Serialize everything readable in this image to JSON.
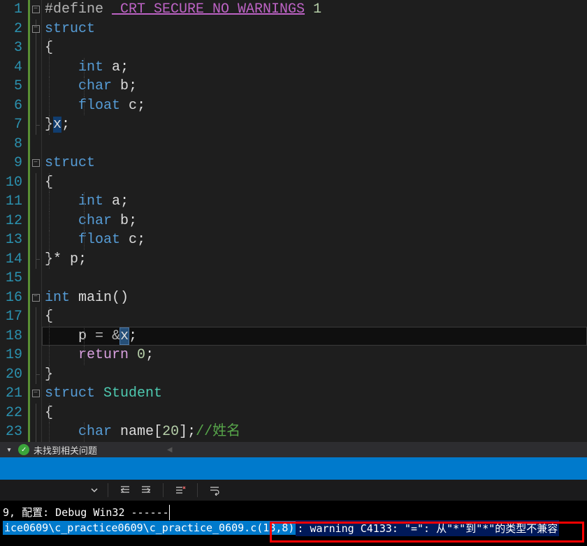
{
  "lines": [
    {
      "n": 1,
      "fold": "box",
      "indent": 0
    },
    {
      "n": 2,
      "fold": "box",
      "indent": 0
    },
    {
      "n": 3,
      "fold": "line",
      "indent": 1
    },
    {
      "n": 4,
      "fold": "line",
      "indent": 2
    },
    {
      "n": 5,
      "fold": "line",
      "indent": 2
    },
    {
      "n": 6,
      "fold": "line",
      "indent": 2
    },
    {
      "n": 7,
      "fold": "end",
      "indent": 1
    },
    {
      "n": 8,
      "fold": "",
      "indent": 0
    },
    {
      "n": 9,
      "fold": "box",
      "indent": 0
    },
    {
      "n": 10,
      "fold": "line",
      "indent": 1
    },
    {
      "n": 11,
      "fold": "line",
      "indent": 2
    },
    {
      "n": 12,
      "fold": "line",
      "indent": 2
    },
    {
      "n": 13,
      "fold": "line",
      "indent": 2
    },
    {
      "n": 14,
      "fold": "end",
      "indent": 1
    },
    {
      "n": 15,
      "fold": "",
      "indent": 0
    },
    {
      "n": 16,
      "fold": "box",
      "indent": 0
    },
    {
      "n": 17,
      "fold": "line",
      "indent": 1
    },
    {
      "n": 18,
      "fold": "line",
      "indent": 2
    },
    {
      "n": 19,
      "fold": "line",
      "indent": 2
    },
    {
      "n": 20,
      "fold": "end",
      "indent": 1
    },
    {
      "n": 21,
      "fold": "box",
      "indent": 0
    },
    {
      "n": 22,
      "fold": "line",
      "indent": 1
    },
    {
      "n": 23,
      "fold": "line",
      "indent": 2
    }
  ],
  "code": {
    "l1_macro": "_CRT_SECURE_NO_WARNINGS",
    "l1_num": "1",
    "kw_struct": "struct",
    "kw_int": "int",
    "kw_char": "char",
    "kw_float": "float",
    "kw_return": "return",
    "var_a": "a",
    "var_b": "b",
    "var_c": "c",
    "var_x": "x",
    "var_p": "p",
    "fn_main": "main",
    "cls_student": "Student",
    "var_name": "name",
    "arr_20": "20",
    "zero": "0",
    "comment_cn": "//姓名"
  },
  "status": {
    "text": "未找到相关问题"
  },
  "output": {
    "line1": "9, 配置: Debug Win32 ------",
    "path": "ice0609\\c_practice0609\\c_practice_0609.c(18,8)",
    "warn": ": warning C4133: \"=\": 从\"*\"到\"*\"的类型不兼容"
  },
  "colors": {
    "accent": "#007acc",
    "warn_bg": "#00195a",
    "error_border": "#ff0000"
  }
}
